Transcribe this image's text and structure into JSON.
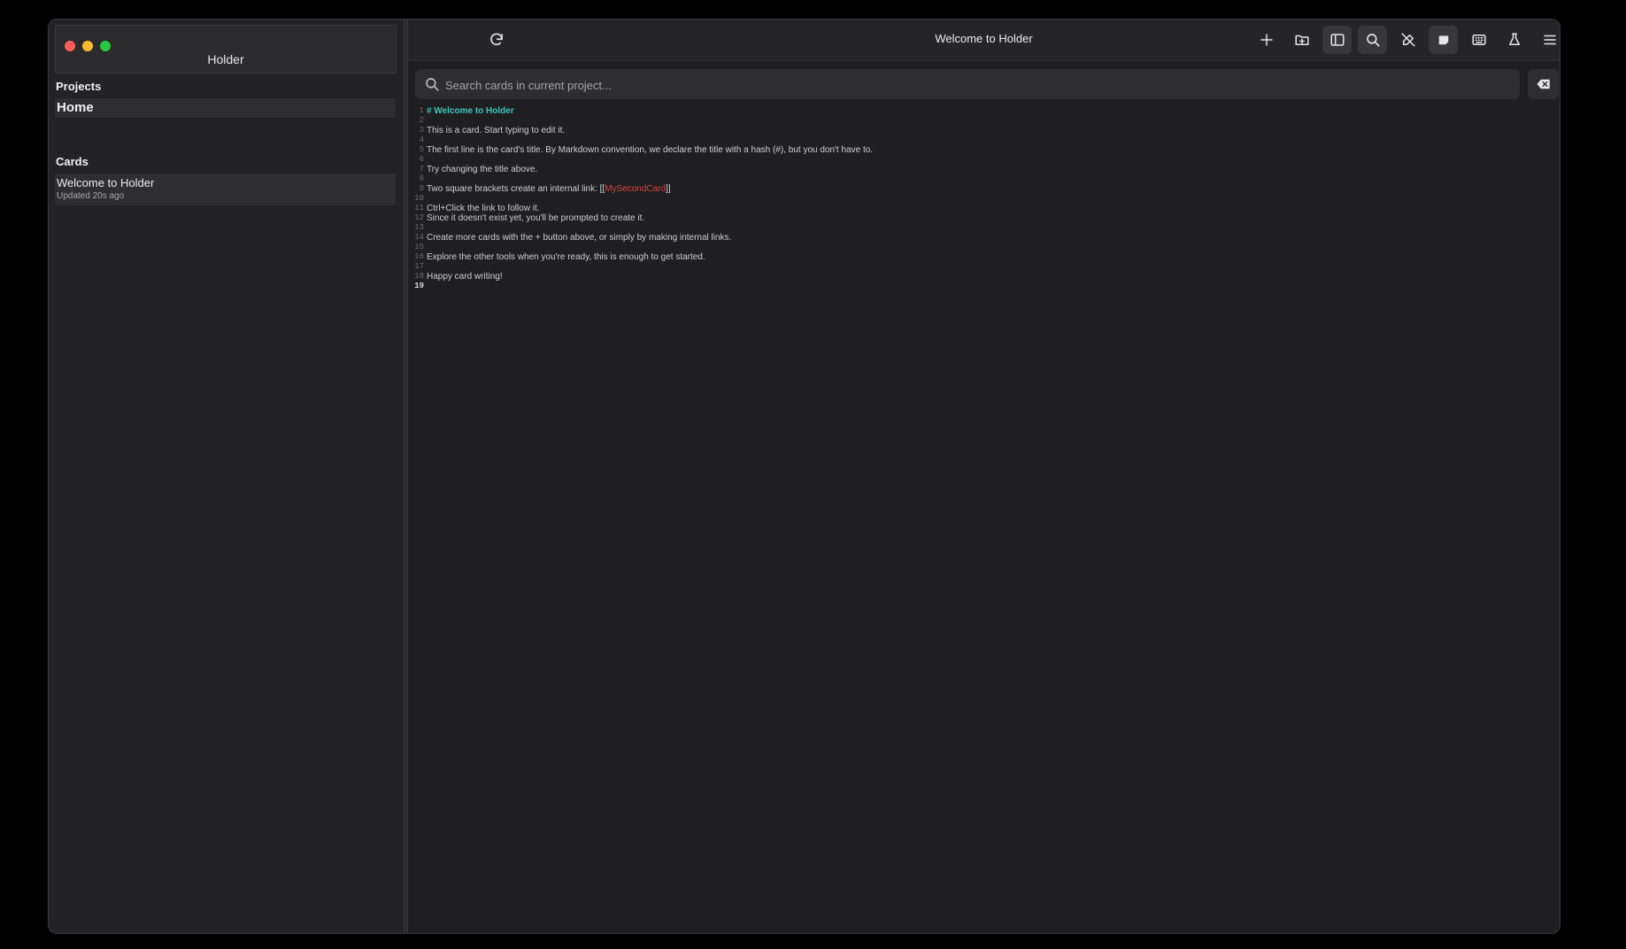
{
  "app": {
    "name": "Holder"
  },
  "sidebar": {
    "projects_title": "Projects",
    "projects": [
      {
        "label": "Home"
      }
    ],
    "cards_title": "Cards",
    "cards": [
      {
        "title": "Welcome to Holder",
        "updated": "Updated 20s ago"
      }
    ]
  },
  "toolbar": {
    "title": "Welcome to Holder",
    "buttons": [
      {
        "icon": "refresh-icon"
      },
      {
        "icon": "plus-icon"
      },
      {
        "icon": "folder-plus-icon"
      },
      {
        "icon": "sidebar-toggle-icon",
        "active": true
      },
      {
        "icon": "search-icon",
        "active": true
      },
      {
        "icon": "pen-off-icon"
      },
      {
        "icon": "card-icon",
        "active": true
      },
      {
        "icon": "keyboard-icon"
      },
      {
        "icon": "flask-icon"
      },
      {
        "icon": "menu-icon"
      }
    ]
  },
  "search": {
    "placeholder": "Search cards in current project..."
  },
  "editor": {
    "lines": [
      {
        "n": "1",
        "text": "# Welcome to Holder",
        "heading": true
      },
      {
        "n": "2",
        "text": ""
      },
      {
        "n": "3",
        "text": "This is a card. Start typing to edit it."
      },
      {
        "n": "4",
        "text": ""
      },
      {
        "n": "5",
        "text": "The first line is the card's title. By Markdown convention, we declare the title with a hash (#), but you don't have to."
      },
      {
        "n": "6",
        "text": ""
      },
      {
        "n": "7",
        "text": "Try changing the title above."
      },
      {
        "n": "8",
        "text": ""
      },
      {
        "n": "9",
        "text_before": "Two square brackets create an internal link: ",
        "link_open": "[[",
        "link_text": "MySecondCard",
        "link_close": "]]"
      },
      {
        "n": "10",
        "text": ""
      },
      {
        "n": "11",
        "text": "Ctrl+Click the link to follow it."
      },
      {
        "n": "12",
        "text": "Since it doesn't exist yet, you'll be prompted to create it."
      },
      {
        "n": "13",
        "text": ""
      },
      {
        "n": "14",
        "text": "Create more cards with the + button above, or simply by making internal links."
      },
      {
        "n": "15",
        "text": ""
      },
      {
        "n": "16",
        "text": "Explore the other tools when you're ready, this is enough to get started."
      },
      {
        "n": "17",
        "text": ""
      },
      {
        "n": "18",
        "text": "Happy card writing!"
      },
      {
        "n": "19",
        "text": "",
        "current": true
      }
    ]
  },
  "colors": {
    "background": "#1f1f22",
    "sidebar": "#232325",
    "heading": "#3ec6b4",
    "link": "#e0413f",
    "traffic_close": "#ff5f57",
    "traffic_min": "#febc2e",
    "traffic_max": "#28c840"
  }
}
